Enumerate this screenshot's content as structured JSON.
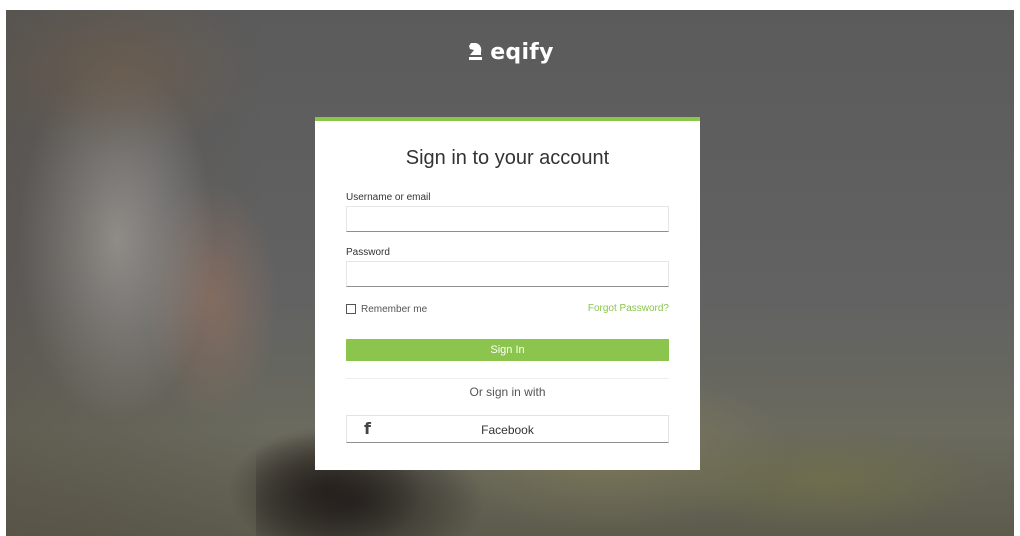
{
  "brand": {
    "name": "eqify",
    "logo_icon": "chess-knight-icon"
  },
  "login": {
    "title": "Sign in to your account",
    "username_label": "Username or email",
    "username_value": "",
    "password_label": "Password",
    "password_value": "",
    "remember_label": "Remember me",
    "remember_checked": false,
    "forgot_label": "Forgot Password?",
    "submit_label": "Sign In",
    "alt_text": "Or sign in with",
    "social": {
      "label": "Facebook",
      "icon": "facebook-icon",
      "icon_glyph": "f"
    }
  },
  "colors": {
    "accent": "#8bc54d",
    "title_text": "#333333",
    "background_overlay": "#5f5f5f"
  }
}
